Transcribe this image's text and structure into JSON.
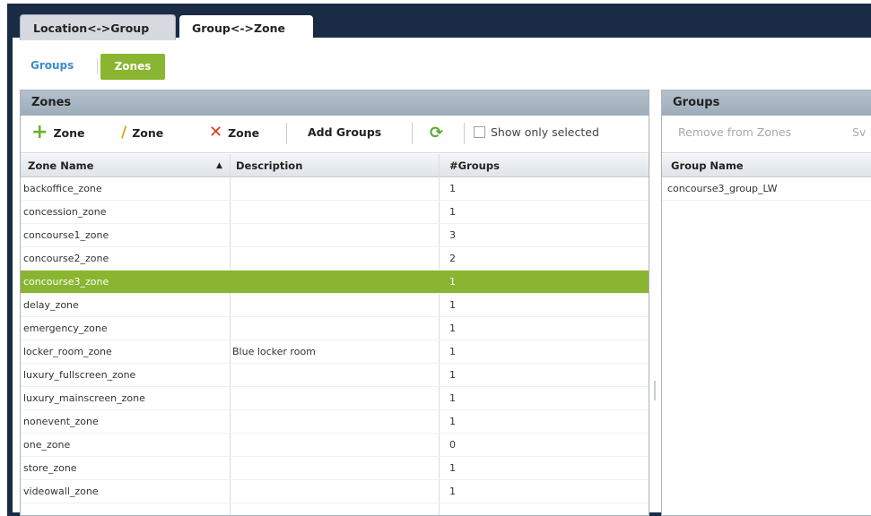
{
  "top_tabs": [
    {
      "label": "Location<->Group"
    },
    {
      "label": "Group<->Zone"
    }
  ],
  "sub_tabs": {
    "groups": "Groups",
    "zones": "Zones"
  },
  "zones_panel": {
    "title": "Zones",
    "toolbar": {
      "add_zone": "Zone",
      "edit_zone": "Zone",
      "delete_zone": "Zone",
      "add_groups": "Add Groups",
      "show_only_selected": "Show only selected"
    },
    "columns": {
      "name": "Zone Name",
      "sort_indicator": "▲",
      "description": "Description",
      "groups": "#Groups"
    },
    "rows": [
      {
        "name": "backoffice_zone",
        "description": "",
        "groups": "1"
      },
      {
        "name": "concession_zone",
        "description": "",
        "groups": "1"
      },
      {
        "name": "concourse1_zone",
        "description": "",
        "groups": "3"
      },
      {
        "name": "concourse2_zone",
        "description": "",
        "groups": "2"
      },
      {
        "name": "concourse3_zone",
        "description": "",
        "groups": "1"
      },
      {
        "name": "delay_zone",
        "description": "",
        "groups": "1"
      },
      {
        "name": "emergency_zone",
        "description": "",
        "groups": "1"
      },
      {
        "name": "locker_room_zone",
        "description": "Blue locker room",
        "groups": "1"
      },
      {
        "name": "luxury_fullscreen_zone",
        "description": "",
        "groups": "1"
      },
      {
        "name": "luxury_mainscreen_zone",
        "description": "",
        "groups": "1"
      },
      {
        "name": "nonevent_zone",
        "description": "",
        "groups": "1"
      },
      {
        "name": "one_zone",
        "description": "",
        "groups": "0"
      },
      {
        "name": "store_zone",
        "description": "",
        "groups": "1"
      },
      {
        "name": "videowall_zone",
        "description": "",
        "groups": "1"
      }
    ]
  },
  "groups_panel": {
    "title": "Groups",
    "toolbar": {
      "remove_from_zones": "Remove from Zones",
      "truncated_button": "Sv"
    },
    "columns": {
      "name": "Group Name"
    },
    "rows": [
      {
        "name": "concourse3_group_LW"
      }
    ]
  },
  "colors": {
    "accent_green": "#8ab530",
    "link_blue": "#3a8ccc",
    "frame_navy": "#1a2c45",
    "delete_red": "#d63b1f"
  }
}
